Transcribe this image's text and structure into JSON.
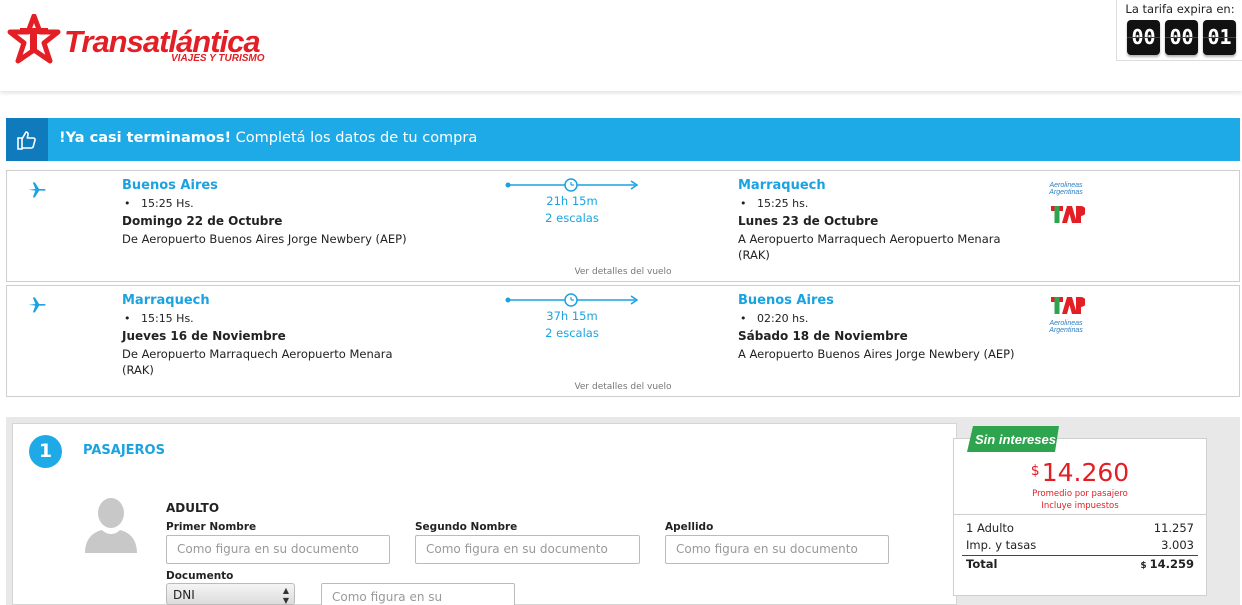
{
  "brand": {
    "name": "Transatlántica",
    "tagline": "VIAJES Y TURISMO",
    "color": "#e31e24"
  },
  "timer": {
    "label": "La tarifa expira en:",
    "hours": "00",
    "minutes": "00",
    "seconds": "01"
  },
  "banner": {
    "bold": "!Ya casi terminamos!",
    "text": " Completá los datos de tu compra",
    "icon": "thumbs-up-icon",
    "color": "#1eaae7"
  },
  "flights": [
    {
      "icon": "plane-outbound-icon",
      "origin_city": "Buenos Aires",
      "origin_time": "15:25 Hs.",
      "origin_date": "Domingo 22 de Octubre",
      "origin_airport": "De Aeropuerto Buenos Aires Jorge Newbery (AEP)",
      "duration": "21h 15m",
      "stops": "2 escalas",
      "dest_city": "Marraquech",
      "dest_time": "15:25 hs.",
      "dest_date": "Lunes 23 de Octubre",
      "dest_airport_1": "A Aeropuerto Marraquech Aeropuerto Menara",
      "dest_airport_2": "(RAK)",
      "details_link": "Ver detalles del vuelo",
      "airline_1": "Aerolineas Argentinas",
      "airline_2": "TAP"
    },
    {
      "icon": "plane-return-icon",
      "origin_city": "Marraquech",
      "origin_time": "15:15 Hs.",
      "origin_date": "Jueves 16 de Noviembre",
      "origin_airport_1": "De Aeropuerto Marraquech Aeropuerto Menara",
      "origin_airport_2": "(RAK)",
      "duration": "37h 15m",
      "stops": "2 escalas",
      "dest_city": "Buenos Aires",
      "dest_time": "02:20 hs.",
      "dest_date": "Sábado 18 de Noviembre",
      "dest_airport": "A Aeropuerto Buenos Aires Jorge Newbery (AEP)",
      "details_link": "Ver detalles del vuelo",
      "airline_1": "TAP",
      "airline_2": "Aerolineas Argentinas"
    }
  ],
  "passengers": {
    "step": "1",
    "title": "PASAJEROS",
    "type": "ADULTO",
    "first_name_label": "Primer Nombre",
    "first_name_placeholder": "Como figura en su documento",
    "second_name_label": "Segundo Nombre",
    "second_name_placeholder": "Como figura en su documento",
    "last_name_label": "Apellido",
    "last_name_placeholder": "Como figura en su documento",
    "document_label": "Documento",
    "document_type": "DNI",
    "document_placeholder": "Como figura en su documento"
  },
  "price": {
    "badge": "Sin intereses",
    "badge_color": "#2ea44f",
    "currency": "$",
    "amount": "14.260",
    "note_1": "Promedio por pasajero",
    "note_2": "Incluye impuestos",
    "rows": [
      {
        "label": "1 Adulto",
        "value": "11.257"
      },
      {
        "label": "Imp. y tasas",
        "value": "3.003"
      }
    ],
    "total_label": "Total",
    "total_currency": "$",
    "total_value": "14.259"
  }
}
